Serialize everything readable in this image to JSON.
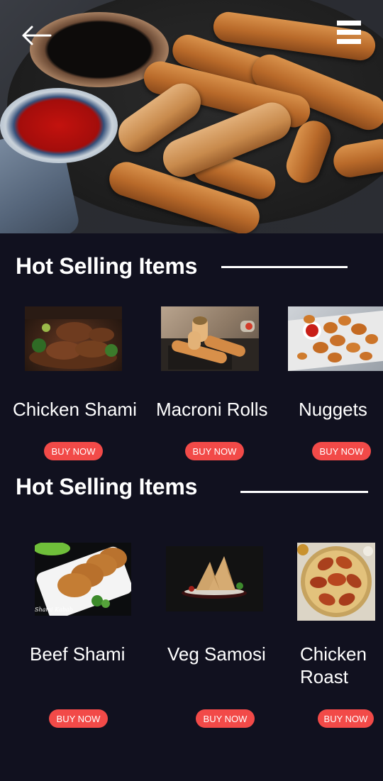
{
  "header": {
    "back_icon": "arrow-left-icon",
    "menu_icon": "hamburger-menu-icon"
  },
  "sections": [
    {
      "title": "Hot Selling Items",
      "items": [
        {
          "name": "Chicken Shami",
          "button": "BUY NOW"
        },
        {
          "name": "Macroni Rolls",
          "button": "BUY NOW"
        },
        {
          "name": "Nuggets",
          "button": "BUY NOW"
        }
      ]
    },
    {
      "title": "Hot Selling Items",
      "items": [
        {
          "name": "Beef Shami",
          "button": "BUY NOW"
        },
        {
          "name": "Veg Samosi",
          "button": "BUY NOW"
        },
        {
          "name": "Chicken\nRoast",
          "button": "BUY NOW"
        }
      ]
    }
  ],
  "image_captions": {
    "beef_shami_caption": "Shami Kabab"
  },
  "colors": {
    "background": "#11111f",
    "button": "#f24a48",
    "text": "#ffffff"
  }
}
